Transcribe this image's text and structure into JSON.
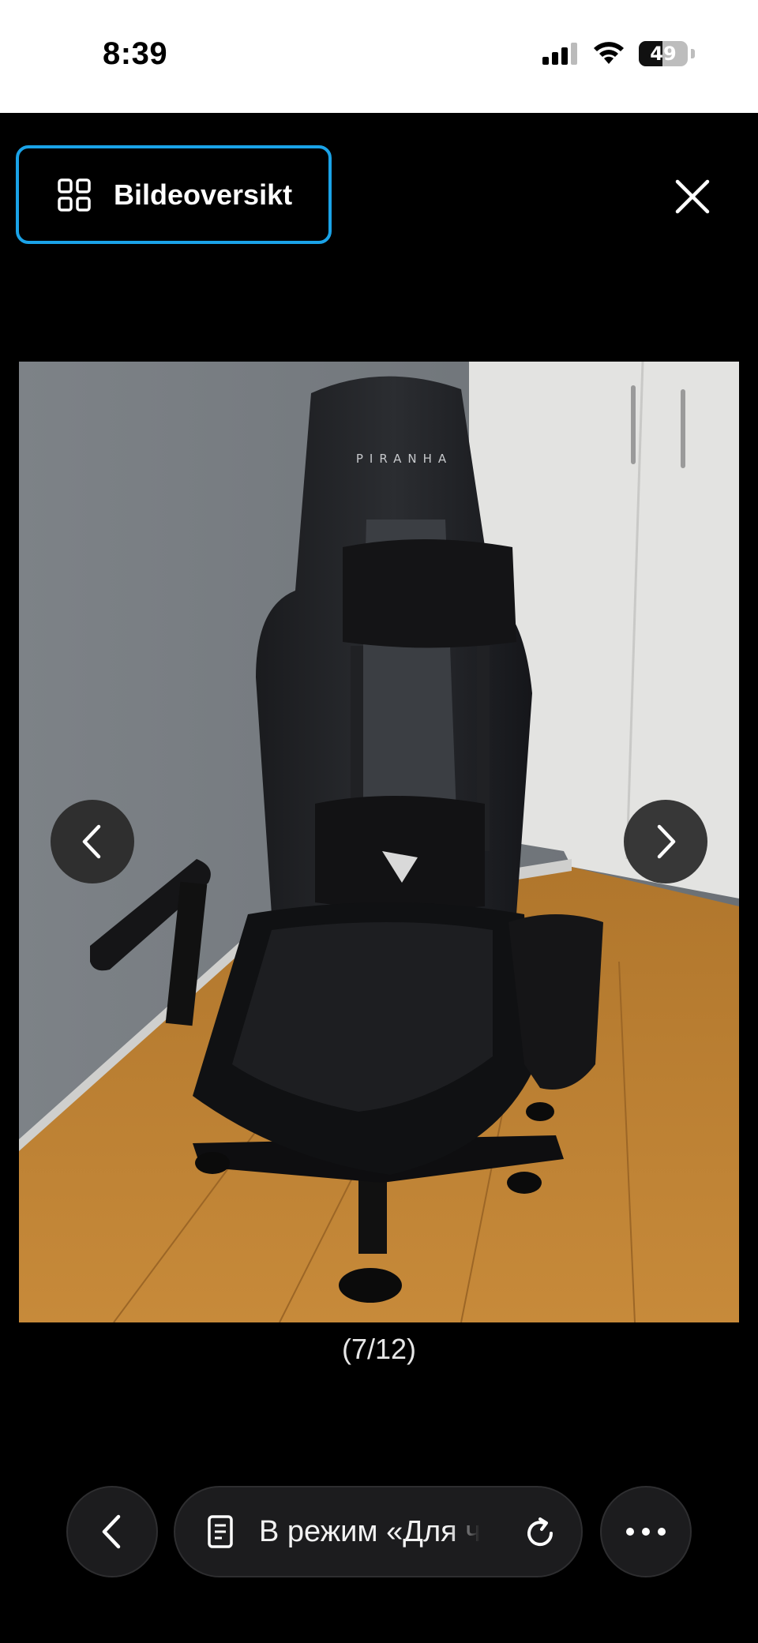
{
  "status_bar": {
    "time": "8:39",
    "battery_level": "49",
    "battery_fraction": 0.49,
    "icons": [
      "cellular-signal-icon",
      "wifi-icon",
      "battery-icon"
    ]
  },
  "viewer": {
    "overview_label": "Bildeoversikt",
    "overview_icon": "grid-icon",
    "close_icon": "close-icon",
    "accent_color": "#1aa3e8",
    "counter": "(7/12)",
    "prev_icon": "chevron-left-icon",
    "next_icon": "chevron-right-icon",
    "photo_brand_text": "PIRANHA"
  },
  "toolbar": {
    "back_icon": "chevron-left-icon",
    "address_text": "В режим «Для чтения»",
    "reader_icon": "document-icon",
    "reload_icon": "reload-icon",
    "more_icon": "ellipsis-icon"
  }
}
